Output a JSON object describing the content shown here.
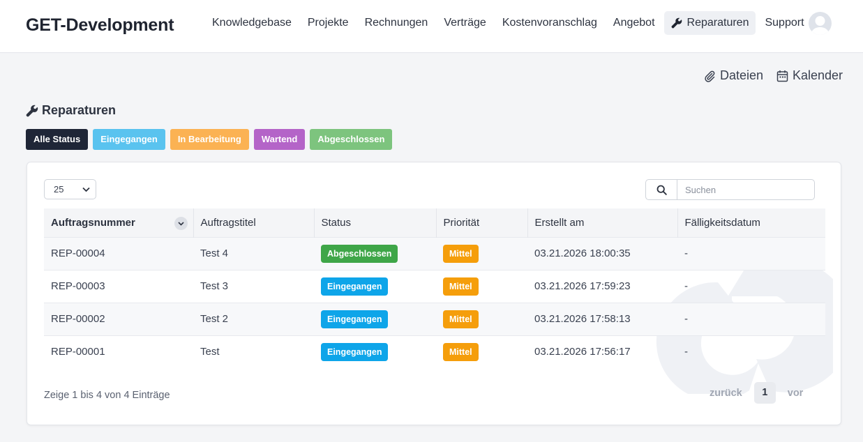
{
  "brand": "GET-Development",
  "nav": [
    {
      "label": "Knowledgebase"
    },
    {
      "label": "Projekte"
    },
    {
      "label": "Rechnungen"
    },
    {
      "label": "Verträge"
    },
    {
      "label": "Kostenvoranschlag"
    },
    {
      "label": "Angebot"
    },
    {
      "label": "Reparaturen",
      "icon": "wrench-icon",
      "active": true
    },
    {
      "label": "Support"
    }
  ],
  "quick_links": {
    "files": "Dateien",
    "calendar": "Kalender"
  },
  "page_title": "Reparaturen",
  "filters": [
    {
      "label": "Alle Status",
      "color": "#1f2637"
    },
    {
      "label": "Eingegangen",
      "color": "#5ac3ef"
    },
    {
      "label": "In Bearbeitung",
      "color": "#fbb253"
    },
    {
      "label": "Wartend",
      "color": "#b464c8"
    },
    {
      "label": "Abgeschlossen",
      "color": "#7dc47e"
    }
  ],
  "table": {
    "page_size": "25",
    "search_placeholder": "Suchen",
    "columns": [
      "Auftragsnummer",
      "Auftragstitel",
      "Status",
      "Priorität",
      "Erstellt am",
      "Fälligkeitsdatum"
    ],
    "rows": [
      {
        "number": "REP-00004",
        "title": "Test 4",
        "status": "Abgeschlossen",
        "priority": "Mittel",
        "created": "03.21.2026 18:00:35",
        "due": "-"
      },
      {
        "number": "REP-00003",
        "title": "Test 3",
        "status": "Eingegangen",
        "priority": "Mittel",
        "created": "03.21.2026 17:59:23",
        "due": "-"
      },
      {
        "number": "REP-00002",
        "title": "Test 2",
        "status": "Eingegangen",
        "priority": "Mittel",
        "created": "03.21.2026 17:58:13",
        "due": "-"
      },
      {
        "number": "REP-00001",
        "title": "Test",
        "status": "Eingegangen",
        "priority": "Mittel",
        "created": "03.21.2026 17:56:17",
        "due": "-"
      }
    ],
    "info": "Zeige 1 bis 4 von 4 Einträge",
    "pager": {
      "prev": "zurück",
      "current": "1",
      "next": "vor"
    }
  },
  "colors": {
    "status_abgeschlossen": "#3fa648",
    "status_eingegangen": "#0ea5e9",
    "priority_mittel": "#f59e0b"
  }
}
